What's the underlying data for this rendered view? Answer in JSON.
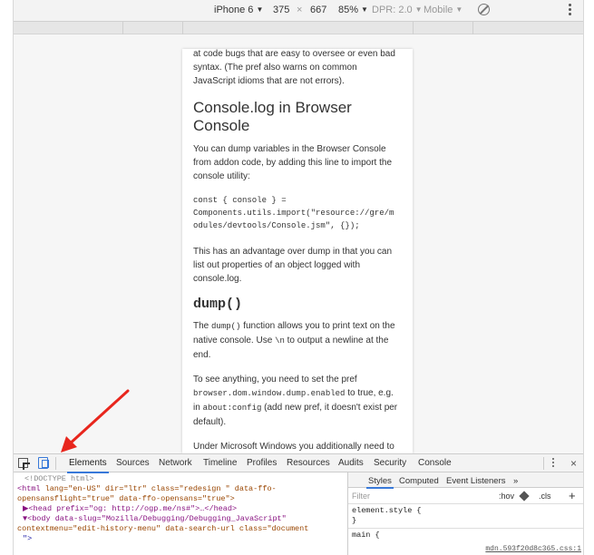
{
  "device_toolbar": {
    "device": "iPhone 6",
    "width": "375",
    "times": "×",
    "height": "667",
    "zoom": "85%",
    "dpr": "DPR: 2.0",
    "mode": "Mobile"
  },
  "page": {
    "intro_cut": "at code bugs that are easy to oversee or even bad syntax. (The pref also warns on common JavaScript idioms that are not errors).",
    "h_console": "Console.log in Browser Console",
    "p_console": "You can dump variables in the Browser Console from addon code, by adding this line to import the console utility:",
    "code": "const { console } =\nComponents.utils.import(\"resource://gre/m\nodules/devtools/Console.jsm\", {});",
    "p_advantage": "This has an advantage over dump in that you can list out properties of an object logged with console.log.",
    "h_dump": "dump()",
    "p_dump_1": "The ",
    "p_dump_code1": "dump()",
    "p_dump_2": " function allows you to print text on the native console. Use ",
    "p_dump_code2": "\\n",
    "p_dump_3": " to output a newline at the end.",
    "p_see_1": "To see anything, you need to set the pref ",
    "p_see_code1": "browser.dom.window.dump.enabled",
    "p_see_2": " to true, e.g. in ",
    "p_see_code2": "about:config",
    "p_see_3": " (add new pref, it doesn't exist per default).",
    "p_windows": "Under Microsoft Windows you additionally need to start Firefox via the following command to have a"
  },
  "devtools": {
    "tabs": [
      "Elements",
      "Sources",
      "Network",
      "Timeline",
      "Profiles",
      "Resources",
      "Audits",
      "Security",
      "Console"
    ],
    "close": "×",
    "dom": {
      "doctype": "<!DOCTYPE html>",
      "l1_tag": "<html ",
      "l1_attrs": "lang=\"en-US\" dir=\"ltr\" class=\"redesign \" data-ffo-",
      "l2": "opensansflight=\"true\" data-ffo-opensans=\"true\">",
      "l3": "▶<head prefix=\"og: http://ogp.me/ns#\">…</head>",
      "l4": "▼<body data-slug=\"Mozilla/Debugging/Debugging_JavaScript\"",
      "l5": "contextmenu=\"edit-history-menu\" data-search-url class=\"document",
      "l6": "\">"
    },
    "styles": {
      "tabs": [
        "Styles",
        "Computed",
        "Event Listeners",
        "»"
      ],
      "filter_placeholder": "Filter",
      "hov": ":hov",
      "cls": ".cls",
      "plus": "+",
      "rule1_a": "element.style {",
      "rule1_b": "}",
      "rule2": "main {",
      "source": "mdn.593f20d8c365.css:1"
    }
  },
  "colors": {
    "accent": "#3879d9",
    "arrow": "#e8261d"
  }
}
